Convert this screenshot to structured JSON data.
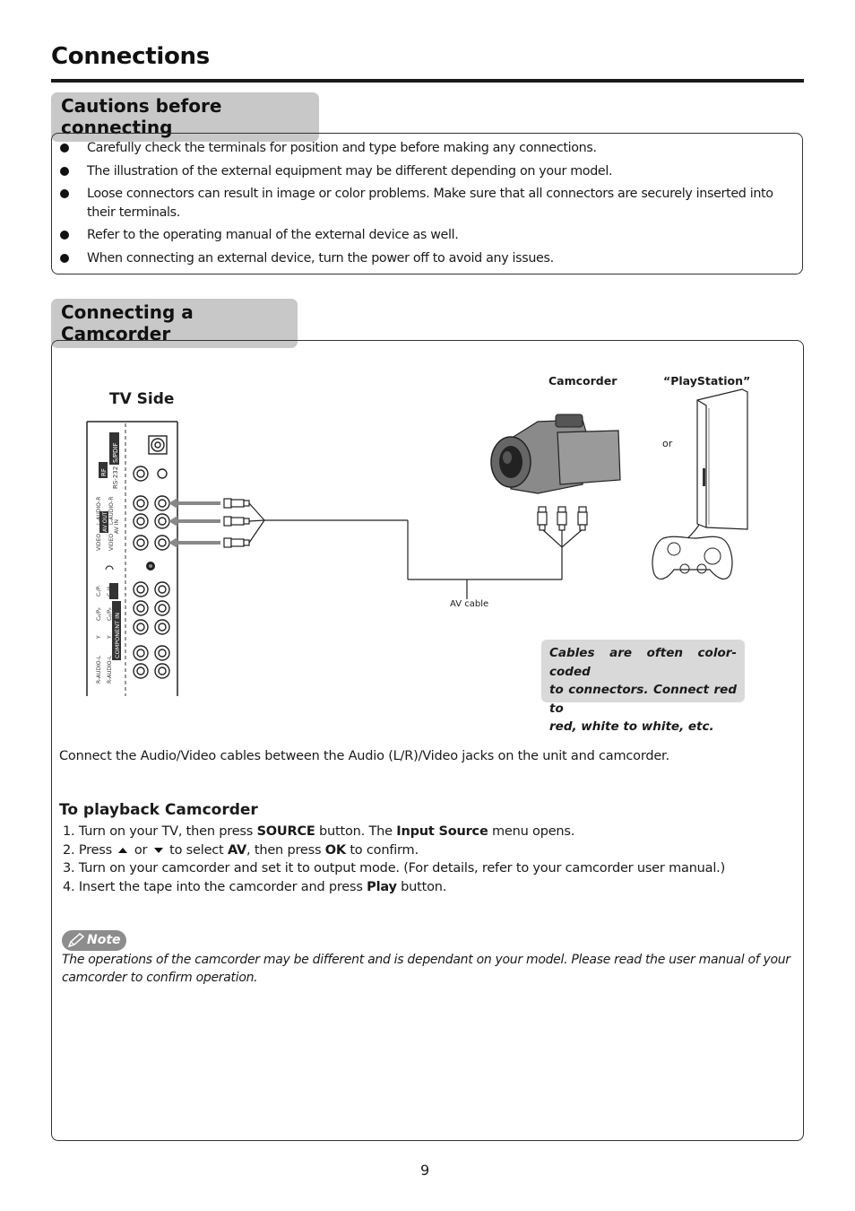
{
  "page": {
    "title": "Connections",
    "number": "9"
  },
  "cautions": {
    "heading": "Cautions before connecting",
    "items": [
      "Carefully check the terminals for position and type before making any connections.",
      "The illustration of the external equipment may be different depending on your model.",
      "Loose connectors can result in image or color problems. Make sure that all connectors are securely inserted into their terminals.",
      "Refer to the operating manual of the external device as well.",
      "When connecting an external device, turn the power off to avoid any issues."
    ]
  },
  "camcorder_section": {
    "heading": "Connecting a Camcorder",
    "diagram": {
      "tv_side_label": "TV Side",
      "camcorder_label": "Camcorder",
      "playstation_label": "“PlayStation”",
      "or_label": "or",
      "av_cable_label": "AV cable",
      "panel_labels": {
        "spdif": "S/PDIF",
        "rf": "RF",
        "rs232": "RS-232",
        "av_out": "AV OUT",
        "av_in": "AV IN",
        "audio_r_out": "L-AUDIO-R",
        "audio_r_in": "L-AUDIO-R",
        "video_out": "VIDEO",
        "video_in": "VIDEO",
        "component_in": "COMPONENT IN",
        "comp2": "2",
        "comp1": "1",
        "cr_pr": "Cᵣ/Pᵣ",
        "cb_pb": "Cᵦ/Pᵦ",
        "y": "Y",
        "audio_l": "R-AUDIO-L"
      },
      "tip_lines": [
        "Cables are often color-coded",
        "to connectors. Connect red to",
        "red, white to white, etc."
      ]
    },
    "instruction": "Connect the Audio/Video cables between the Audio (L/R)/Video jacks on the unit and camcorder.",
    "playback": {
      "heading": "To playback Camcorder",
      "step1": {
        "a": " 1. Turn on your TV,  then press ",
        "b": "SOURCE",
        "c": " button. The ",
        "d": "Input Source",
        "e": " menu opens."
      },
      "step2": {
        "a": " 2. Press ",
        "or": " or ",
        "b": " to select ",
        "c": "AV",
        "d": ", then press ",
        "e": "OK",
        "f": " to confirm.",
        "up_icon": "arrow-up",
        "down_icon": "arrow-down"
      },
      "step3": " 3. Turn on your camcorder and set it to output mode. (For details, refer to your camcorder user manual.)",
      "step4": {
        "a": " 4. Insert the tape into the camcorder and press ",
        "b": "Play",
        "c": " button."
      }
    },
    "note": {
      "label": "Note",
      "icon": "pencil-icon",
      "text": "The operations of the camcorder may be different and is dependant on your model. Please read the user manual of your camcorder to confirm operation."
    }
  }
}
